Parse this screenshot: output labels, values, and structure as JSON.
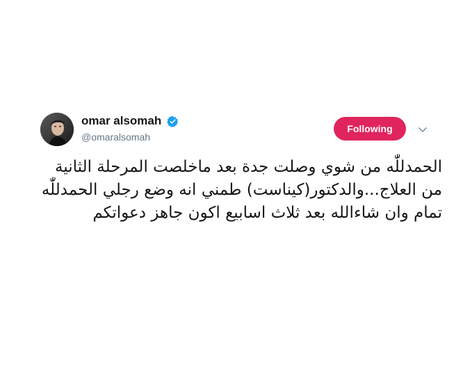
{
  "user": {
    "display_name": "omar alsomah",
    "handle": "@omaralsomah",
    "verified": true,
    "avatar_icon": "profile-photo"
  },
  "actions": {
    "follow_label": "Following",
    "follow_color": "#e0245e",
    "more_icon": "chevron-down-icon"
  },
  "tweet": {
    "text": "الحمدللّٰه من شوي وصلت جدة بعد ماخلصت المرحلة الثانية من العلاج...والدكتور(كيناست) طمني انه وضع رجلي الحمدللّٰه تمام وان شاءالله بعد ثلاث اسابيع اكون جاهز دعواتكم"
  },
  "colors": {
    "verified_blue": "#1da1f2",
    "secondary_text": "#657786"
  }
}
